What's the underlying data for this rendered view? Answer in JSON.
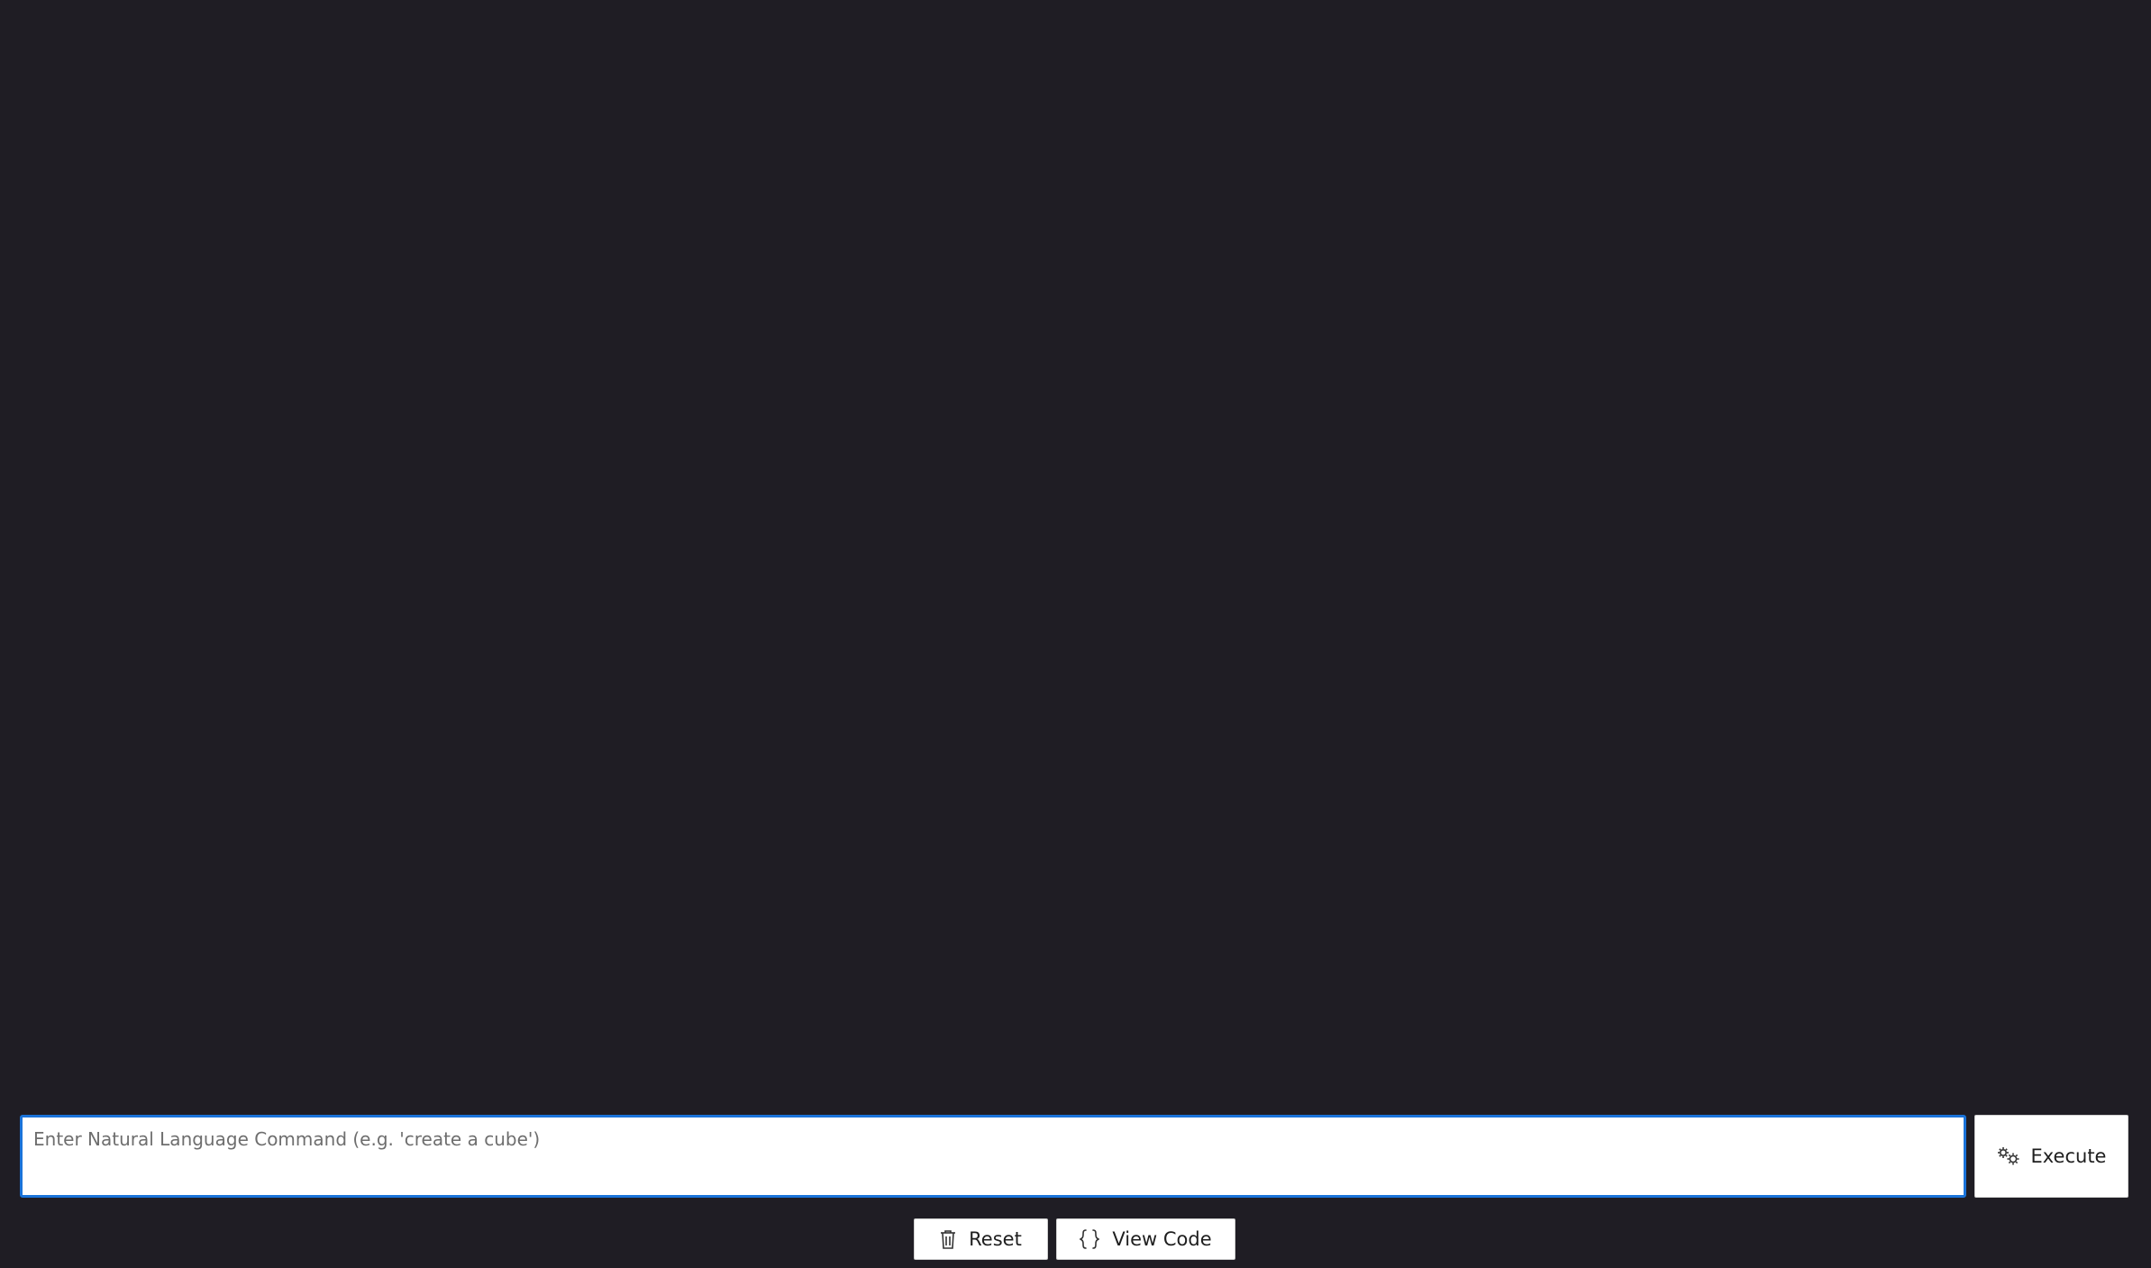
{
  "command": {
    "placeholder": "Enter Natural Language Command (e.g. 'create a cube')",
    "value": ""
  },
  "buttons": {
    "execute_label": "Execute",
    "reset_label": "Reset",
    "view_code_label": "View Code"
  },
  "icons": {
    "execute": "gears-icon",
    "reset": "trash-icon",
    "view_code": "braces-icon"
  },
  "colors": {
    "background": "#1f1d24",
    "input_focus_border": "#1a73d9",
    "button_bg": "#ffffff"
  }
}
